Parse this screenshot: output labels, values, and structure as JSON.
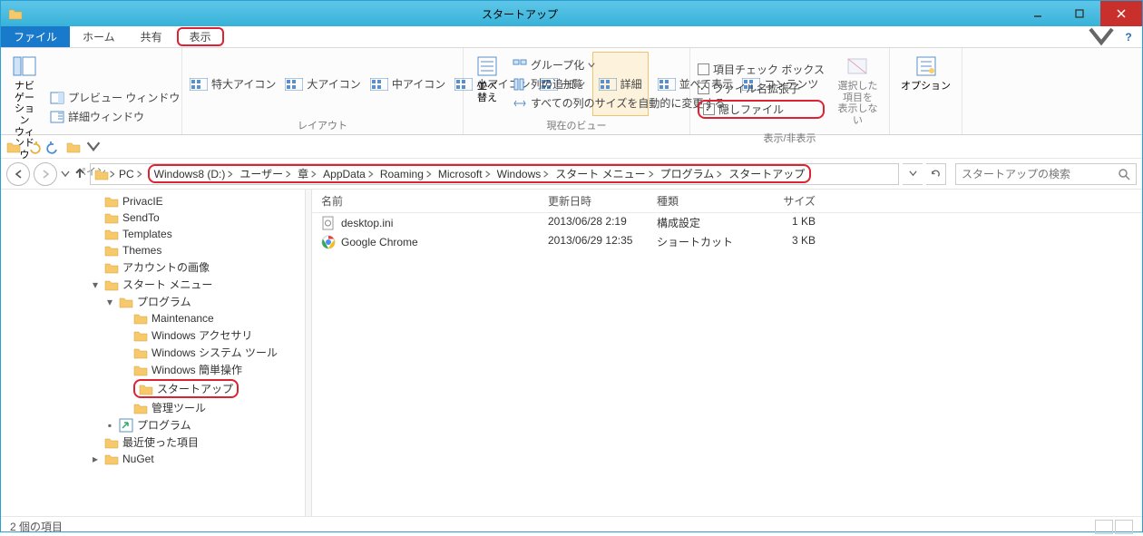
{
  "window": {
    "title": "スタートアップ"
  },
  "tabs": {
    "file": "ファイル",
    "home": "ホーム",
    "share": "共有",
    "view": "表示"
  },
  "ribbon": {
    "pane": {
      "nav": "ナビゲーション\nウィンドウ",
      "preview": "プレビュー ウィンドウ",
      "details": "詳細ウィンドウ",
      "label": "ペイン"
    },
    "layout": {
      "xl": "特大アイコン",
      "l": "大アイコン",
      "m": "中アイコン",
      "s": "小アイコン",
      "list": "一覧",
      "detail": "詳細",
      "tile": "並べて表示",
      "content": "コンテンツ",
      "label": "レイアウト"
    },
    "view": {
      "sort": "並べ替え",
      "group": "グループ化",
      "addcol": "列の追加",
      "autosize": "すべての列のサイズを自動的に変更する",
      "label": "現在のビュー"
    },
    "show": {
      "check": "項目チェック ボックス",
      "ext": "ファイル名拡張子",
      "hidden": "隠しファイル",
      "hidebtn": "選択した項目を\n表示しない",
      "label": "表示/非表示"
    },
    "options": "オプション"
  },
  "breadcrumb": [
    "PC",
    "Windows8 (D:)",
    "ユーザー",
    "章",
    "AppData",
    "Roaming",
    "Microsoft",
    "Windows",
    "スタート メニュー",
    "プログラム",
    "スタートアップ"
  ],
  "search_placeholder": "スタートアップの検索",
  "columns": {
    "name": "名前",
    "date": "更新日時",
    "type": "種類",
    "size": "サイズ"
  },
  "files": [
    {
      "name": "desktop.ini",
      "date": "2013/06/28 2:19",
      "type": "構成設定",
      "size": "1 KB",
      "icon": "ini"
    },
    {
      "name": "Google Chrome",
      "date": "2013/06/29 12:35",
      "type": "ショートカット",
      "size": "3 KB",
      "icon": "chrome"
    }
  ],
  "tree": [
    {
      "indent": 1,
      "name": "PrivacIE",
      "icon": "folder"
    },
    {
      "indent": 1,
      "name": "SendTo",
      "icon": "folder"
    },
    {
      "indent": 1,
      "name": "Templates",
      "icon": "folder"
    },
    {
      "indent": 1,
      "name": "Themes",
      "icon": "folder"
    },
    {
      "indent": 1,
      "name": "アカウントの画像",
      "icon": "folder"
    },
    {
      "indent": 1,
      "name": "スタート メニュー",
      "icon": "folder",
      "expanded": true
    },
    {
      "indent": 2,
      "name": "プログラム",
      "icon": "folder",
      "expanded": true
    },
    {
      "indent": 3,
      "name": "Maintenance",
      "icon": "folder"
    },
    {
      "indent": 3,
      "name": "Windows アクセサリ",
      "icon": "folder"
    },
    {
      "indent": 3,
      "name": "Windows システム ツール",
      "icon": "folder"
    },
    {
      "indent": 3,
      "name": "Windows 簡単操作",
      "icon": "folder"
    },
    {
      "indent": 3,
      "name": "スタートアップ",
      "icon": "folder",
      "highlight": true
    },
    {
      "indent": 3,
      "name": "管理ツール",
      "icon": "folder"
    },
    {
      "indent": 2,
      "name": "プログラム",
      "icon": "shortcut",
      "exp": "▪"
    },
    {
      "indent": 1,
      "name": "最近使った項目",
      "icon": "recent"
    },
    {
      "indent": 1,
      "name": "NuGet",
      "icon": "folder",
      "collapsed": true
    }
  ],
  "status": "2 個の項目"
}
